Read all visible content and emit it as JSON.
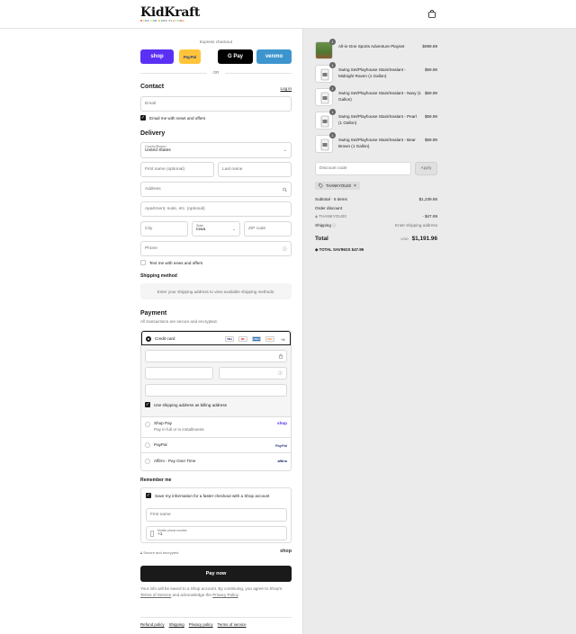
{
  "header": {
    "logo": "KidKraft",
    "tagline": "MADE FOR MORE PLAYTIME"
  },
  "express": {
    "label": "Express checkout",
    "or": "OR",
    "buttons": [
      {
        "label": "shop",
        "bg": "#5a31f4",
        "fg": "#ffffff"
      },
      {
        "label": "PayPal",
        "bg": "#ffc439",
        "fg": "#253b80"
      },
      {
        "label": "G Pay",
        "bg": "#000000",
        "fg": "#ffffff"
      },
      {
        "label": "venmo",
        "bg": "#3d95ce",
        "fg": "#ffffff"
      }
    ]
  },
  "contact": {
    "title": "Contact",
    "login": "Log in",
    "email_placeholder": "Email",
    "news_label": "Email me with news and offers"
  },
  "delivery": {
    "title": "Delivery",
    "country_label": "Country/Region",
    "country_value": "United States",
    "first_name": "First name (optional)",
    "last_name": "Last name",
    "address": "Address",
    "apartment": "Apartment, suite, etc. (optional)",
    "city": "City",
    "state_label": "State",
    "state_value": "Iowa",
    "zip": "ZIP code",
    "phone": "Phone",
    "text_label": "Text me with news and offers"
  },
  "shipping_method": {
    "title": "Shipping method",
    "note": "Enter your shipping address to view available shipping methods."
  },
  "payment": {
    "title": "Payment",
    "subtitle": "All transactions are secure and encrypted.",
    "credit_card": "Credit card",
    "card_more": "+4",
    "billing_same": "Use shipping address as billing address",
    "shop_pay": "Shop Pay",
    "shop_pay_sub": "Pay in full or in installments",
    "shop_pay_logo": "shop",
    "paypal": "PayPal",
    "paypal_logo": "PayPal",
    "affirm": "Affirm - Pay Over Time",
    "affirm_logo": "affirm",
    "cards": [
      {
        "label": "VISA",
        "bg": "#ffffff",
        "fg": "#1a1f71"
      },
      {
        "label": "MC",
        "bg": "#ffffff",
        "fg": "#eb001b"
      },
      {
        "label": "AMEX",
        "bg": "#2e77bc",
        "fg": "#ffffff"
      },
      {
        "label": "DISC",
        "bg": "#ffffff",
        "fg": "#f58220"
      }
    ]
  },
  "remember": {
    "title": "Remember me",
    "save_label": "Save my information for a faster checkout with a Shop account",
    "first_name": "First name",
    "mobile_label": "Mobile phone number",
    "mobile_value": "+1",
    "secure": "Secure and encrypted",
    "shop_logo": "shop"
  },
  "pay_now": "Pay now",
  "legal": {
    "text1": "Your info will be saved to a Shop account. By continuing, you agree to Shop's",
    "terms": "Terms of Service",
    "text2": " and acknowledge the ",
    "privacy": "Privacy Policy",
    "text3": "."
  },
  "footer": {
    "links": [
      "Refund policy",
      "Shipping",
      "Privacy policy",
      "Terms of service"
    ]
  },
  "order": {
    "items": [
      {
        "name": "All-in-One Sports Adventure Playset",
        "price": "$999.99",
        "qty": "1"
      },
      {
        "name": "Swing Set/Playhouse Stain/Sealant - Midnight Raven (1 Gallon)",
        "price": "$59.99",
        "qty": "1"
      },
      {
        "name": "Swing Set/Playhouse Stain/Sealant - Navy (1 Gallon)",
        "price": "$59.99",
        "qty": "1"
      },
      {
        "name": "Swing Set/Playhouse Stain/Sealant - Pearl (1 Gallon)",
        "price": "$59.99",
        "qty": "1"
      },
      {
        "name": "Swing Set/Playhouse Stain/Sealant - Bear Brown (1 Gallon)",
        "price": "$59.99",
        "qty": "1"
      }
    ],
    "discount_placeholder": "Discount code",
    "apply": "Apply",
    "code_tag": "THANKYOU20",
    "subtotal_label": "Subtotal · 5 items",
    "subtotal": "$1,239.95",
    "order_discount_label": "Order discount",
    "discount_code": "THANKYOU20",
    "discount_value": "- $47.99",
    "shipping_label": "Shipping",
    "shipping_value": "Enter shipping address",
    "total_label": "Total",
    "currency": "USD",
    "total": "$1,191.96",
    "savings_label": "TOTAL SAVINGS",
    "savings": "$47.99"
  }
}
